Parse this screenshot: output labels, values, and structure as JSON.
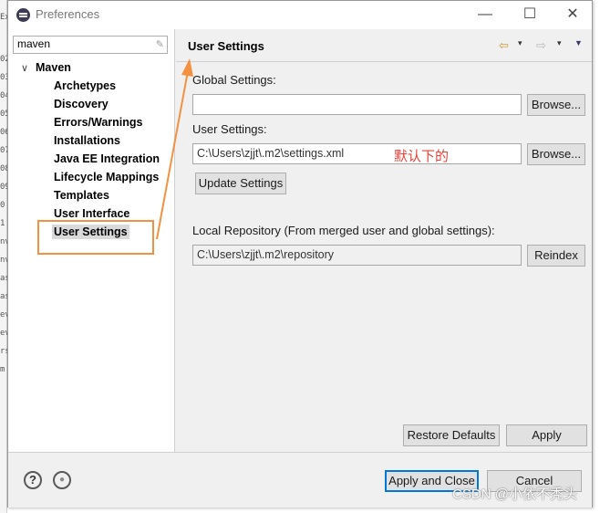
{
  "background": {
    "side_fragments": [
      "Ex",
      "02",
      "03",
      "04",
      "05",
      "06",
      "07",
      "08",
      "09",
      "0",
      "1",
      "nv",
      "nv",
      "as",
      "as",
      "ev",
      "ev",
      "rs",
      "m"
    ]
  },
  "window": {
    "title": "Preferences",
    "minimize_glyph": "—",
    "maximize_glyph": "☐",
    "close_glyph": "✕"
  },
  "sidebar": {
    "filter_value": "maven",
    "filter_clear_glyph": "✎",
    "root": {
      "caret": "∨",
      "label": "Maven"
    },
    "items": [
      {
        "label": "Archetypes"
      },
      {
        "label": "Discovery"
      },
      {
        "label": "Errors/Warnings"
      },
      {
        "label": "Installations"
      },
      {
        "label": "Java EE Integration"
      },
      {
        "label": "Lifecycle Mappings"
      },
      {
        "label": "Templates"
      },
      {
        "label": "User Interface"
      },
      {
        "label": "User Settings"
      }
    ],
    "selected": "User Settings"
  },
  "page": {
    "title": "User Settings",
    "nav": {
      "back_glyph": "⇦",
      "forward_glyph": "⇨",
      "dropdown_glyph": "▾",
      "menu_glyph": "▼"
    },
    "global_settings": {
      "label": "Global Settings:",
      "value": "",
      "browse": "Browse..."
    },
    "user_settings": {
      "label": "User Settings:",
      "value": "C:\\Users\\zjjt\\.m2\\settings.xml",
      "browse": "Browse..."
    },
    "annotation": "默认下的",
    "update_button": "Update Settings",
    "local_repo": {
      "label": "Local Repository (From merged user and global settings):",
      "value": "C:\\Users\\zjjt\\.m2\\repository",
      "reindex": "Reindex"
    },
    "restore_defaults": "Restore Defaults",
    "apply": "Apply"
  },
  "footer": {
    "help_glyph": "?",
    "import_glyph": "●",
    "apply_close": "Apply and Close",
    "cancel": "Cancel",
    "watermark": "CSDN @小依不秃头"
  },
  "colors": {
    "annotation_orange": "#f39142",
    "annotation_red": "#e8413a",
    "default_button_blue": "#0078d7"
  }
}
